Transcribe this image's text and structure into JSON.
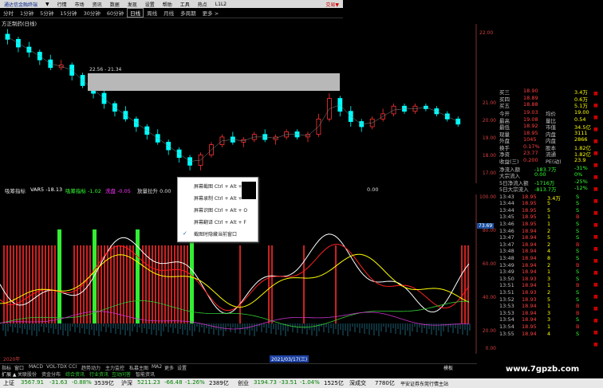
{
  "menubar": {
    "brand": "通达信金融终端",
    "items": [
      "行情",
      "市场",
      "资讯",
      "数据",
      "发现",
      "设置",
      "帮助",
      "工具",
      "热点",
      "L1L2"
    ],
    "trade": "交易▼",
    "menu_arrow": "▼"
  },
  "periodbar": {
    "items": [
      "分时",
      "1分钟",
      "5分钟",
      "15分钟",
      "30分钟",
      "60分钟",
      "日线",
      "周线",
      "月线",
      "多周期",
      "更多 >"
    ],
    "selected": "日线"
  },
  "stock_title": "方正制药(日线)",
  "price_annotation": "22.56 - 21.34",
  "price_axis": [
    "22.00",
    "21.00",
    "20.00",
    "19.00",
    "18.00",
    "17.00"
  ],
  "quote": {
    "rows": [
      {
        "l": "买三",
        "v": "18.90",
        "r": "3.4万"
      },
      {
        "l": "买四",
        "v": "18.89",
        "r": "0.6万"
      },
      {
        "l": "买五",
        "v": "18.88",
        "r": "5.1万"
      },
      {
        "l": "今开",
        "v": "19.03",
        "m": "均价",
        "r": "19.00"
      },
      {
        "l": "最高",
        "v": "19.08",
        "m": "量比",
        "r": "0.54"
      },
      {
        "l": "最低",
        "v": "18.92",
        "m": "市值",
        "r": "34.5亿"
      },
      {
        "l": "现量",
        "v": "18.95",
        "m": "内盘",
        "r": "3111"
      },
      {
        "l": "外盘",
        "v": "1045",
        "m": "内盘",
        "r": "2866"
      },
      {
        "l": "换手",
        "v": "0.17%",
        "m": "股本",
        "r": "1.82亿"
      },
      {
        "l": "净资",
        "v": "23.77",
        "m": "流通",
        "r": "1.82亿"
      },
      {
        "l": "收益(三)",
        "v": "0.200",
        "m": "PE(动)",
        "r": "23.9"
      },
      {
        "l": "净流入额",
        "v": "",
        "m": "-183.7万",
        "r": "-31%"
      },
      {
        "l": "大宗流入",
        "v": "",
        "m": "0.00",
        "r": "0%"
      },
      {
        "l": "5日净流入额",
        "v": "",
        "m": "-1716万",
        "r": "-25%"
      },
      {
        "l": "5日大宗流入",
        "v": "",
        "m": "-813.7万",
        "r": "-12%"
      }
    ],
    "ticks": [
      {
        "t": "13:43",
        "p": "18.95",
        "v": "3.4万",
        "s": "S"
      },
      {
        "t": "13:44",
        "p": "18.95",
        "v": "5",
        "s": "S"
      },
      {
        "t": "13:44",
        "p": "18.95",
        "v": "5",
        "s": "S"
      },
      {
        "t": "13:45",
        "p": "18.95",
        "v": "1",
        "s": "B"
      },
      {
        "t": "13:46",
        "p": "18.95",
        "v": "1",
        "s": "S"
      },
      {
        "t": "13:46",
        "p": "18.94",
        "v": "2",
        "s": "S"
      },
      {
        "t": "13:47",
        "p": "18.94",
        "v": "5",
        "s": "S"
      },
      {
        "t": "13:47",
        "p": "18.94",
        "v": "2",
        "s": "B"
      },
      {
        "t": "13:48",
        "p": "18.94",
        "v": "4",
        "s": "S"
      },
      {
        "t": "13:48",
        "p": "18.94",
        "v": "8",
        "s": "S"
      },
      {
        "t": "13:49",
        "p": "18.94",
        "v": "2",
        "s": "B"
      },
      {
        "t": "13:49",
        "p": "18.94",
        "v": "1",
        "s": "S"
      },
      {
        "t": "13:50",
        "p": "18.93",
        "v": "3",
        "s": "S"
      },
      {
        "t": "13:51",
        "p": "18.94",
        "v": "1",
        "s": "B"
      },
      {
        "t": "13:51",
        "p": "18.93",
        "v": "2",
        "s": "S"
      },
      {
        "t": "13:52",
        "p": "18.93",
        "v": "5",
        "s": "S"
      },
      {
        "t": "13:53",
        "p": "18.94",
        "v": "1",
        "s": "B"
      },
      {
        "t": "13:53",
        "p": "18.94",
        "v": "3",
        "s": "B"
      },
      {
        "t": "13:54",
        "p": "18.94",
        "v": "3",
        "s": "S"
      },
      {
        "t": "13:54",
        "p": "18.95",
        "v": "1",
        "s": "B"
      },
      {
        "t": "13:55",
        "p": "18.94",
        "v": "4",
        "s": "S"
      }
    ]
  },
  "indicator": {
    "name": "吸筹指标",
    "var5": "VAR5 -18.13",
    "label2": "吸筹指标 -1.02",
    "label3": "洗盘 -0.05",
    "label4": "放量拉升 0.00",
    "label5": "0.00"
  },
  "ind_axis": [
    "100.00",
    "80.00",
    "60.00",
    "40.00",
    "20.00",
    "0.00"
  ],
  "ind_marker": "73.69",
  "context_menu": {
    "items": [
      "屏幕截图 Ctrl + Alt + A",
      "屏幕录制 Ctrl + Alt +",
      "屏幕识图 Ctrl + Alt + O",
      "屏幕翻译 Ctrl + Alt + F",
      "截图时隐藏当前窗口"
    ]
  },
  "date_label": "2021/03/17(三)",
  "date_left": "2020年",
  "tabs": {
    "row1": [
      "指标",
      "窗口",
      "MACD",
      "VOL-TDX",
      "CCI",
      "趋势动力",
      "主力监控",
      "私募主图",
      "MA2",
      "更多",
      "设置"
    ],
    "row2": [
      "扩展 ▲",
      "关联股份",
      "资金分布",
      "综合资讯",
      "行业资讯",
      "互动问答",
      "智能资讯"
    ],
    "right": "模板",
    "right2": "收藏"
  },
  "status": {
    "idx1": "上证",
    "v1": "3567.91",
    "c1": "-31.63",
    "p1": "-0.88%",
    "a1": "3539亿",
    "idx2": "沪深",
    "v2": "5211.23",
    "c2": "-66.48",
    "p2": "-1.26%",
    "a2": "2389亿",
    "idx3": "创业",
    "v3": "3194.73",
    "c3": "-33.51",
    "p3": "-1.04%",
    "a3": "1525亿",
    "idx4": "深成交",
    "a4": "7780亿",
    "broker": "平安证券东莞行情主站"
  },
  "watermark": "www.7gpzb.com",
  "colors": {
    "up": "#ff3333",
    "down": "#00ffff",
    "green": "#33ff33",
    "yellow": "#ffff00"
  },
  "chart_data": {
    "type": "line",
    "title": "方正制药(日线)",
    "candles": [
      {
        "o": 22.6,
        "c": 22.4,
        "h": 22.8,
        "l": 22.2
      },
      {
        "o": 22.4,
        "c": 22.1,
        "h": 22.5,
        "l": 21.9
      },
      {
        "o": 22.1,
        "c": 21.9,
        "h": 22.3,
        "l": 21.7
      },
      {
        "o": 21.9,
        "c": 21.6,
        "h": 22.0,
        "l": 21.4
      },
      {
        "o": 21.6,
        "c": 21.3,
        "h": 21.8,
        "l": 21.2
      },
      {
        "o": 21.3,
        "c": 21.4,
        "h": 21.6,
        "l": 21.2
      },
      {
        "o": 21.4,
        "c": 21.0,
        "h": 21.5,
        "l": 20.8
      },
      {
        "o": 21.0,
        "c": 20.6,
        "h": 21.1,
        "l": 20.5
      },
      {
        "o": 20.6,
        "c": 20.3,
        "h": 20.7,
        "l": 20.1
      },
      {
        "o": 20.3,
        "c": 19.9,
        "h": 20.4,
        "l": 19.7
      },
      {
        "o": 19.9,
        "c": 19.6,
        "h": 20.0,
        "l": 19.4
      },
      {
        "o": 19.6,
        "c": 19.3,
        "h": 19.8,
        "l": 19.2
      },
      {
        "o": 19.3,
        "c": 19.0,
        "h": 19.4,
        "l": 18.8
      },
      {
        "o": 19.0,
        "c": 18.7,
        "h": 19.1,
        "l": 18.5
      },
      {
        "o": 18.7,
        "c": 18.4,
        "h": 18.9,
        "l": 18.3
      },
      {
        "o": 18.4,
        "c": 18.1,
        "h": 18.5,
        "l": 17.9
      },
      {
        "o": 18.1,
        "c": 17.8,
        "h": 18.2,
        "l": 17.6
      },
      {
        "o": 17.8,
        "c": 17.5,
        "h": 17.9,
        "l": 17.3
      },
      {
        "o": 17.5,
        "c": 17.9,
        "h": 18.0,
        "l": 17.3
      },
      {
        "o": 17.9,
        "c": 18.3,
        "h": 18.4,
        "l": 17.8
      },
      {
        "o": 18.3,
        "c": 18.6,
        "h": 18.7,
        "l": 18.2
      },
      {
        "o": 18.6,
        "c": 18.4,
        "h": 18.8,
        "l": 18.3
      },
      {
        "o": 18.4,
        "c": 18.5,
        "h": 18.6,
        "l": 18.2
      },
      {
        "o": 18.5,
        "c": 18.7,
        "h": 18.8,
        "l": 18.4
      },
      {
        "o": 18.7,
        "c": 18.5,
        "h": 18.9,
        "l": 18.4
      },
      {
        "o": 18.5,
        "c": 18.6,
        "h": 18.7,
        "l": 18.3
      },
      {
        "o": 18.6,
        "c": 18.8,
        "h": 18.9,
        "l": 18.5
      },
      {
        "o": 18.8,
        "c": 18.6,
        "h": 18.9,
        "l": 18.5
      },
      {
        "o": 18.6,
        "c": 18.7,
        "h": 18.8,
        "l": 18.4
      },
      {
        "o": 18.7,
        "c": 19.3,
        "h": 19.5,
        "l": 18.6
      },
      {
        "o": 19.3,
        "c": 20.1,
        "h": 20.3,
        "l": 19.2
      },
      {
        "o": 20.1,
        "c": 19.6,
        "h": 20.2,
        "l": 19.4
      },
      {
        "o": 19.6,
        "c": 19.2,
        "h": 19.8,
        "l": 19.0
      },
      {
        "o": 19.2,
        "c": 19.0,
        "h": 19.3,
        "l": 18.8
      },
      {
        "o": 19.0,
        "c": 19.3,
        "h": 19.4,
        "l": 18.9
      },
      {
        "o": 19.3,
        "c": 19.5,
        "h": 19.7,
        "l": 19.2
      },
      {
        "o": 19.5,
        "c": 19.8,
        "h": 19.9,
        "l": 19.4
      },
      {
        "o": 19.8,
        "c": 19.6,
        "h": 19.9,
        "l": 19.5
      },
      {
        "o": 19.6,
        "c": 19.8,
        "h": 19.9,
        "l": 19.5
      },
      {
        "o": 19.8,
        "c": 19.7,
        "h": 19.9,
        "l": 19.6
      },
      {
        "o": 19.7,
        "c": 19.5,
        "h": 19.8,
        "l": 19.4
      },
      {
        "o": 19.5,
        "c": 19.3,
        "h": 19.6,
        "l": 19.2
      },
      {
        "o": 19.3,
        "c": 19.1,
        "h": 19.4,
        "l": 19.0
      }
    ],
    "ylim": [
      16.8,
      23.0
    ]
  }
}
